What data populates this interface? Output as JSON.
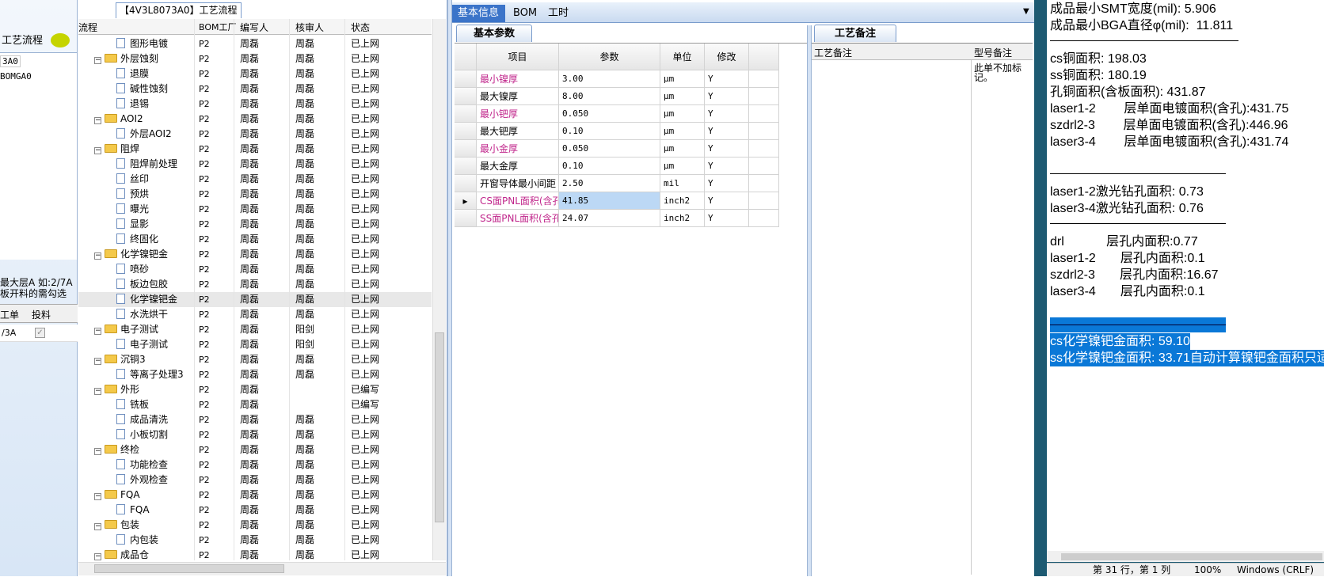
{
  "left": {
    "title": "工艺流程",
    "wo1": "3A0",
    "wo2": "BOMGA0",
    "note_line1": "最大层A 如:2/7A",
    "note_line2": "板开料的需勾选",
    "grid_col1": "工单",
    "grid_col2": "投料",
    "grid_row1": "/3A"
  },
  "tree": {
    "tab_label": "【4V3L8073A0】工艺流程",
    "headers": [
      "流程",
      "BOM工厂",
      "编写人",
      "核审人",
      "状态"
    ],
    "rows": [
      {
        "name": "图形电镀",
        "level": 2,
        "type": "doc",
        "bom": "P2",
        "writer": "周磊",
        "reviewer": "周磊",
        "status": "已上网"
      },
      {
        "name": "外层蚀刻",
        "level": 1,
        "type": "folder",
        "bom": "P2",
        "writer": "周磊",
        "reviewer": "周磊",
        "status": "已上网"
      },
      {
        "name": "退膜",
        "level": 2,
        "type": "doc",
        "bom": "P2",
        "writer": "周磊",
        "reviewer": "周磊",
        "status": "已上网"
      },
      {
        "name": "碱性蚀刻",
        "level": 2,
        "type": "doc",
        "bom": "P2",
        "writer": "周磊",
        "reviewer": "周磊",
        "status": "已上网"
      },
      {
        "name": "退锡",
        "level": 2,
        "type": "doc",
        "bom": "P2",
        "writer": "周磊",
        "reviewer": "周磊",
        "status": "已上网"
      },
      {
        "name": "AOI2",
        "level": 1,
        "type": "folder",
        "bom": "P2",
        "writer": "周磊",
        "reviewer": "周磊",
        "status": "已上网"
      },
      {
        "name": "外层AOI2",
        "level": 2,
        "type": "doc",
        "bom": "P2",
        "writer": "周磊",
        "reviewer": "周磊",
        "status": "已上网"
      },
      {
        "name": "阻焊",
        "level": 1,
        "type": "folder",
        "bom": "P2",
        "writer": "周磊",
        "reviewer": "周磊",
        "status": "已上网"
      },
      {
        "name": "阻焊前处理",
        "level": 2,
        "type": "doc",
        "bom": "P2",
        "writer": "周磊",
        "reviewer": "周磊",
        "status": "已上网"
      },
      {
        "name": "丝印",
        "level": 2,
        "type": "doc",
        "bom": "P2",
        "writer": "周磊",
        "reviewer": "周磊",
        "status": "已上网"
      },
      {
        "name": "预烘",
        "level": 2,
        "type": "doc",
        "bom": "P2",
        "writer": "周磊",
        "reviewer": "周磊",
        "status": "已上网"
      },
      {
        "name": "曝光",
        "level": 2,
        "type": "doc",
        "bom": "P2",
        "writer": "周磊",
        "reviewer": "周磊",
        "status": "已上网"
      },
      {
        "name": "显影",
        "level": 2,
        "type": "doc",
        "bom": "P2",
        "writer": "周磊",
        "reviewer": "周磊",
        "status": "已上网"
      },
      {
        "name": "终固化",
        "level": 2,
        "type": "doc",
        "bom": "P2",
        "writer": "周磊",
        "reviewer": "周磊",
        "status": "已上网"
      },
      {
        "name": "化学镍钯金",
        "level": 1,
        "type": "folder",
        "bom": "P2",
        "writer": "周磊",
        "reviewer": "周磊",
        "status": "已上网"
      },
      {
        "name": "喷砂",
        "level": 2,
        "type": "doc",
        "bom": "P2",
        "writer": "周磊",
        "reviewer": "周磊",
        "status": "已上网"
      },
      {
        "name": "板边包胶",
        "level": 2,
        "type": "doc",
        "bom": "P2",
        "writer": "周磊",
        "reviewer": "周磊",
        "status": "已上网"
      },
      {
        "name": "化学镍钯金",
        "level": 2,
        "type": "doc",
        "bom": "P2",
        "writer": "周磊",
        "reviewer": "周磊",
        "status": "已上网",
        "selected": true
      },
      {
        "name": "水洗烘干",
        "level": 2,
        "type": "doc",
        "bom": "P2",
        "writer": "周磊",
        "reviewer": "周磊",
        "status": "已上网"
      },
      {
        "name": "电子测试",
        "level": 1,
        "type": "folder",
        "bom": "P2",
        "writer": "周磊",
        "reviewer": "阳剑",
        "status": "已上网"
      },
      {
        "name": "电子测试",
        "level": 2,
        "type": "doc",
        "bom": "P2",
        "writer": "周磊",
        "reviewer": "阳剑",
        "status": "已上网"
      },
      {
        "name": "沉铜3",
        "level": 1,
        "type": "folder",
        "bom": "P2",
        "writer": "周磊",
        "reviewer": "周磊",
        "status": "已上网"
      },
      {
        "name": "等离子处理3",
        "level": 2,
        "type": "doc",
        "bom": "P2",
        "writer": "周磊",
        "reviewer": "周磊",
        "status": "已上网"
      },
      {
        "name": "外形",
        "level": 1,
        "type": "folder",
        "bom": "P2",
        "writer": "周磊",
        "reviewer": "",
        "status": "已编写"
      },
      {
        "name": "铣板",
        "level": 2,
        "type": "doc",
        "bom": "P2",
        "writer": "周磊",
        "reviewer": "",
        "status": "已编写"
      },
      {
        "name": "成品清洗",
        "level": 2,
        "type": "doc",
        "bom": "P2",
        "writer": "周磊",
        "reviewer": "周磊",
        "status": "已上网"
      },
      {
        "name": "小板切割",
        "level": 2,
        "type": "doc",
        "bom": "P2",
        "writer": "周磊",
        "reviewer": "周磊",
        "status": "已上网"
      },
      {
        "name": "终检",
        "level": 1,
        "type": "folder",
        "bom": "P2",
        "writer": "周磊",
        "reviewer": "周磊",
        "status": "已上网"
      },
      {
        "name": "功能检查",
        "level": 2,
        "type": "doc",
        "bom": "P2",
        "writer": "周磊",
        "reviewer": "周磊",
        "status": "已上网"
      },
      {
        "name": "外观检查",
        "level": 2,
        "type": "doc",
        "bom": "P2",
        "writer": "周磊",
        "reviewer": "周磊",
        "status": "已上网"
      },
      {
        "name": "FQA",
        "level": 1,
        "type": "folder",
        "bom": "P2",
        "writer": "周磊",
        "reviewer": "周磊",
        "status": "已上网"
      },
      {
        "name": "FQA",
        "level": 2,
        "type": "doc",
        "bom": "P2",
        "writer": "周磊",
        "reviewer": "周磊",
        "status": "已上网"
      },
      {
        "name": "包装",
        "level": 1,
        "type": "folder",
        "bom": "P2",
        "writer": "周磊",
        "reviewer": "周磊",
        "status": "已上网"
      },
      {
        "name": "内包装",
        "level": 2,
        "type": "doc",
        "bom": "P2",
        "writer": "周磊",
        "reviewer": "周磊",
        "status": "已上网"
      },
      {
        "name": "成品仓",
        "level": 1,
        "type": "folder",
        "bom": "P2",
        "writer": "周磊",
        "reviewer": "周磊",
        "status": "已上网"
      }
    ]
  },
  "mid": {
    "tabs": [
      "基本信息",
      "BOM",
      "工时"
    ],
    "params_tab": "基本参数",
    "notes_tab": "工艺备注",
    "headers": [
      "项目",
      "参数",
      "单位",
      "修改"
    ],
    "rows": [
      {
        "item": "最小镍厚",
        "value": "3.00",
        "unit": "μm",
        "mod": "Y",
        "pink": true
      },
      {
        "item": "最大镍厚",
        "value": "8.00",
        "unit": "μm",
        "mod": "Y",
        "pink": false
      },
      {
        "item": "最小钯厚",
        "value": "0.050",
        "unit": "μm",
        "mod": "Y",
        "pink": true
      },
      {
        "item": "最大钯厚",
        "value": "0.10",
        "unit": "μm",
        "mod": "Y",
        "pink": false
      },
      {
        "item": "最小金厚",
        "value": "0.050",
        "unit": "μm",
        "mod": "Y",
        "pink": true
      },
      {
        "item": "最大金厚",
        "value": "0.10",
        "unit": "μm",
        "mod": "Y",
        "pink": false
      },
      {
        "item": "开窗导体最小间距",
        "value": "2.50",
        "unit": "mil",
        "mod": "Y",
        "pink": false
      },
      {
        "item": "CS面PNL面积(含孔)",
        "value": "41.85",
        "unit": "inch2",
        "mod": "Y",
        "pink": true,
        "current": true
      },
      {
        "item": "SS面PNL面积(含孔)",
        "value": "24.07",
        "unit": "inch2",
        "mod": "Y",
        "pink": true
      }
    ],
    "notes_col1": "工艺备注",
    "notes_col2": "型号备注",
    "model_note": "此单不加标记。"
  },
  "text": {
    "lines": [
      {
        "t": "成品最小SMT宽度(mil): 5.906"
      },
      {
        "t": "成品最小BGA直径φ(mil):  11.811"
      },
      {
        "hr": true
      },
      {
        "t": "cs铜面积: 198.03"
      },
      {
        "t": "ss铜面积: 180.19"
      },
      {
        "t": "孔铜面积(含板面积): 431.87"
      },
      {
        "t": "laser1-2        层单面电镀面积(含孔):431.75"
      },
      {
        "t": "szdrl2-3        层单面电镀面积(含孔):446.96"
      },
      {
        "t": "laser3-4        层单面电镀面积(含孔):431.74"
      },
      {
        "t": ""
      },
      {
        "hr": true
      },
      {
        "t": "laser1-2激光钻孔面积: 0.73"
      },
      {
        "t": "laser3-4激光钻孔面积: 0.76"
      },
      {
        "hr": true
      },
      {
        "t": "drl            层孔内面积:0.77"
      },
      {
        "t": "laser1-2       层孔内面积:0.1"
      },
      {
        "t": "szdrl2-3       层孔内面积:16.67"
      },
      {
        "t": "laser3-4       层孔内面积:0.1"
      },
      {
        "t": ""
      },
      {
        "hl": true,
        "hrbar": true
      },
      {
        "t": "cs化学镍钯金面积: 59.10",
        "hl": true
      },
      {
        "t": "ss化学镍钯金面积: 33.71自动计算镍钯金面积只适",
        "hl": true
      }
    ],
    "status_pos": "第 31 行，第 1 列",
    "status_zoom": "100%",
    "status_eol": "Windows (CRLF)"
  }
}
